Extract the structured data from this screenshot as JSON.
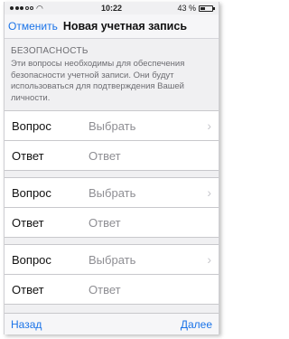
{
  "status_bar": {
    "carrier_signal": "signal-dots",
    "time": "10:22",
    "battery_text": "43 %",
    "battery_level": 0.43
  },
  "nav": {
    "cancel_label": "Отменить",
    "title": "Новая учетная запись"
  },
  "section": {
    "header": "БЕЗОПАСНОСТЬ",
    "description": "Эти вопросы необходимы для обеспечения безопасности учетной записи. Они будут использоваться для подтверждения Вашей личности."
  },
  "rows": [
    {
      "label": "Вопрос",
      "value": "Выбрать"
    },
    {
      "label": "Ответ",
      "value": "Ответ"
    },
    {
      "label": "Вопрос",
      "value": "Выбрать"
    },
    {
      "label": "Ответ",
      "value": "Ответ"
    },
    {
      "label": "Вопрос",
      "value": "Выбрать"
    },
    {
      "label": "Ответ",
      "value": "Ответ"
    }
  ],
  "toolbar": {
    "back_label": "Назад",
    "next_label": "Далее"
  },
  "colors": {
    "accent": "#1a73e8",
    "placeholder": "#8e8e93",
    "background": "#f0f0f2"
  }
}
